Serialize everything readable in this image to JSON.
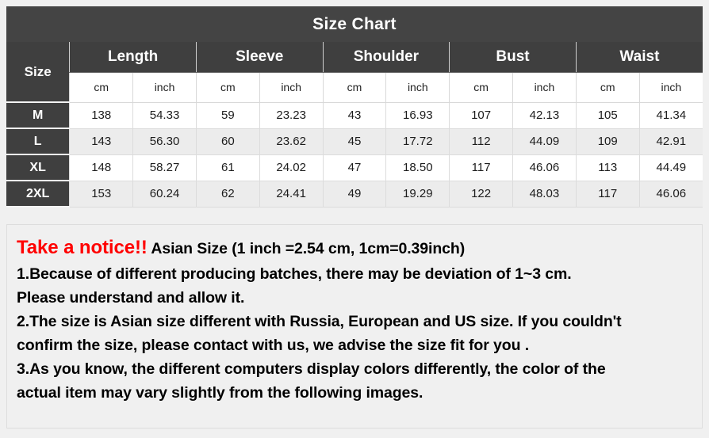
{
  "chart": {
    "title": "Size Chart",
    "size_header": "Size",
    "groups": [
      "Length",
      "Sleeve",
      "Shoulder",
      "Bust",
      "Waist"
    ],
    "units": [
      "cm",
      "inch"
    ],
    "rows": [
      {
        "size": "M",
        "values": [
          "138",
          "54.33",
          "59",
          "23.23",
          "43",
          "16.93",
          "107",
          "42.13",
          "105",
          "41.34"
        ]
      },
      {
        "size": "L",
        "values": [
          "143",
          "56.30",
          "60",
          "23.62",
          "45",
          "17.72",
          "112",
          "44.09",
          "109",
          "42.91"
        ]
      },
      {
        "size": "XL",
        "values": [
          "148",
          "58.27",
          "61",
          "24.02",
          "47",
          "18.50",
          "117",
          "46.06",
          "113",
          "44.49"
        ]
      },
      {
        "size": "2XL",
        "values": [
          "153",
          "60.24",
          "62",
          "24.41",
          "49",
          "19.29",
          "122",
          "48.03",
          "117",
          "46.06"
        ]
      }
    ]
  },
  "notice": {
    "heading_red": "Take a notice!!",
    "heading_rest": "Asian Size (1 inch =2.54 cm, 1cm=0.39inch)",
    "lines": [
      "1.Because of different producing batches, there may be deviation of 1~3 cm.",
      "Please understand and allow it.",
      "2.The size is Asian size different with Russia, European and US size. If you couldn't",
      "confirm the size, please contact with us, we advise the size fit for you .",
      "3.As you know, the different computers display colors differently, the color of the",
      "actual item may vary slightly from the following images."
    ]
  },
  "colors": {
    "header_dark": "#3f3f3f",
    "title_dark": "#444444",
    "page_bg": "#f0f0f0",
    "row_alt": "#ececec",
    "accent_red": "#ff0000"
  }
}
